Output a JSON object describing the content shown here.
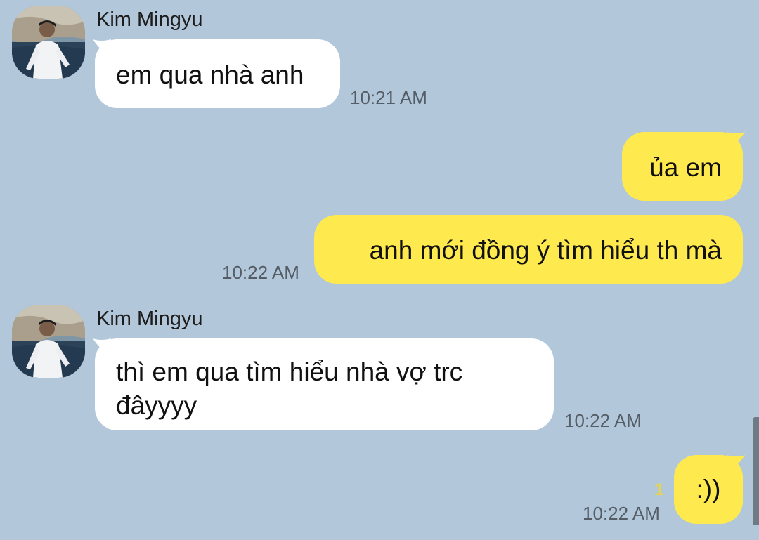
{
  "messages": [
    {
      "sender": "Kim Mingyu",
      "text": "em qua nhà anh",
      "time": "10:21 AM"
    },
    {
      "text": "ủa em"
    },
    {
      "text": "anh mới đồng ý tìm hiểu th mà",
      "time": "10:22 AM"
    },
    {
      "sender": "Kim Mingyu",
      "text": "thì em qua tìm hiểu nhà vợ trc đâyyyy",
      "time": "10:22 AM"
    },
    {
      "text": ":))",
      "time": "10:22 AM",
      "unread": "1"
    }
  ],
  "colors": {
    "background": "#b2c7da",
    "incoming_bubble": "#ffffff",
    "outgoing_bubble": "#fee94e",
    "unread_count": "#e9d34a"
  },
  "icons": {
    "avatar": "profile-photo"
  }
}
